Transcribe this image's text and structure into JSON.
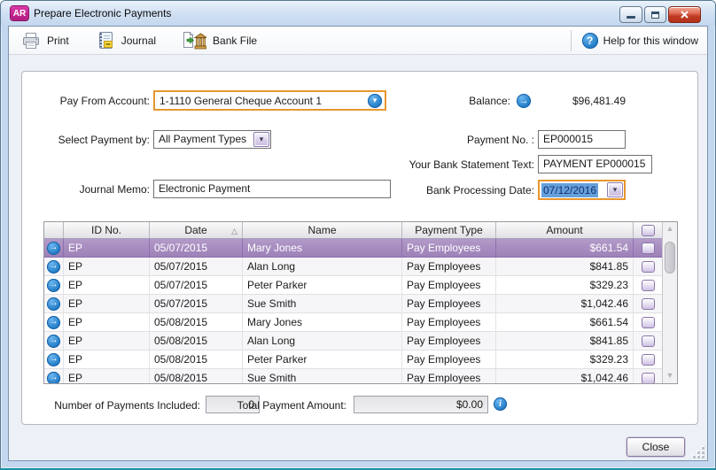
{
  "window": {
    "badge": "AR",
    "title": "Prepare Electronic Payments"
  },
  "toolbar": {
    "print": "Print",
    "journal": "Journal",
    "bank_file": "Bank File",
    "help": "Help for this window"
  },
  "icons": {
    "help_glyph": "?",
    "info_glyph": "i",
    "arrow_right_glyph": "→",
    "chevron_down_glyph": "▾",
    "scroll_up_glyph": "▲",
    "scroll_down_glyph": "▼",
    "sort_ascending_glyph": "△"
  },
  "form": {
    "pay_from_account": {
      "label": "Pay From Account:",
      "value": "1-1110 General Cheque Account 1"
    },
    "balance": {
      "label": "Balance:",
      "value": "$96,481.49"
    },
    "select_payment_by": {
      "label": "Select Payment by:",
      "value": "All Payment Types"
    },
    "payment_no": {
      "label": "Payment No. :",
      "value": "EP000015"
    },
    "bank_statement_text": {
      "label": "Your Bank Statement Text:",
      "value": "PAYMENT EP000015"
    },
    "journal_memo": {
      "label": "Journal Memo:",
      "value": "Electronic Payment"
    },
    "bank_processing_date": {
      "label": "Bank Processing Date:",
      "value": "07/12/2016"
    }
  },
  "table": {
    "headers": {
      "id": "ID No.",
      "date": "Date",
      "name": "Name",
      "type": "Payment Type",
      "amount": "Amount"
    },
    "sort": {
      "column": "Date",
      "direction": "ascending"
    },
    "rows": [
      {
        "id": "EP",
        "date": "05/07/2015",
        "name": "Mary Jones",
        "type": "Pay Employees",
        "amount": "$661.54",
        "selected": true,
        "checked": false
      },
      {
        "id": "EP",
        "date": "05/07/2015",
        "name": "Alan Long",
        "type": "Pay Employees",
        "amount": "$841.85",
        "selected": false,
        "checked": false
      },
      {
        "id": "EP",
        "date": "05/07/2015",
        "name": "Peter Parker",
        "type": "Pay Employees",
        "amount": "$329.23",
        "selected": false,
        "checked": false
      },
      {
        "id": "EP",
        "date": "05/07/2015",
        "name": "Sue Smith",
        "type": "Pay Employees",
        "amount": "$1,042.46",
        "selected": false,
        "checked": false
      },
      {
        "id": "EP",
        "date": "05/08/2015",
        "name": "Mary Jones",
        "type": "Pay Employees",
        "amount": "$661.54",
        "selected": false,
        "checked": false
      },
      {
        "id": "EP",
        "date": "05/08/2015",
        "name": "Alan Long",
        "type": "Pay Employees",
        "amount": "$841.85",
        "selected": false,
        "checked": false
      },
      {
        "id": "EP",
        "date": "05/08/2015",
        "name": "Peter Parker",
        "type": "Pay Employees",
        "amount": "$329.23",
        "selected": false,
        "checked": false
      },
      {
        "id": "EP",
        "date": "05/08/2015",
        "name": "Sue Smith",
        "type": "Pay Employees",
        "amount": "$1,042.46",
        "selected": false,
        "checked": false
      }
    ]
  },
  "summary": {
    "payments_included": {
      "label": "Number of Payments Included:",
      "value": "0"
    },
    "total_payment": {
      "label": "Total Payment Amount:",
      "value": "$0.00"
    }
  },
  "footer": {
    "close": "Close"
  },
  "colors": {
    "focus_orange": "#E8962E",
    "selection_purple": "#A58ABE",
    "brand_magenta": "#C2258E",
    "link_blue": "#2080C8",
    "titlebar_blue": "#C3D7EE",
    "close_red": "#C13B24",
    "date_selection_blue": "#66A0DC"
  }
}
